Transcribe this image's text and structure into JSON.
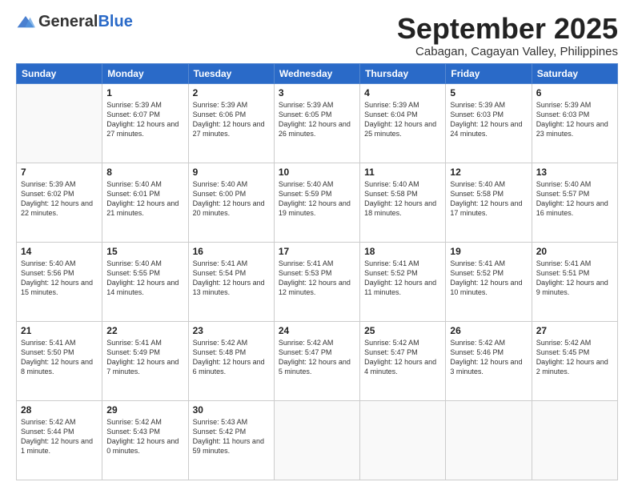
{
  "header": {
    "logo_general": "General",
    "logo_blue": "Blue",
    "month_title": "September 2025",
    "location": "Cabagan, Cagayan Valley, Philippines"
  },
  "weekdays": [
    "Sunday",
    "Monday",
    "Tuesday",
    "Wednesday",
    "Thursday",
    "Friday",
    "Saturday"
  ],
  "weeks": [
    [
      {
        "day": "",
        "info": ""
      },
      {
        "day": "1",
        "info": "Sunrise: 5:39 AM\nSunset: 6:07 PM\nDaylight: 12 hours\nand 27 minutes."
      },
      {
        "day": "2",
        "info": "Sunrise: 5:39 AM\nSunset: 6:06 PM\nDaylight: 12 hours\nand 27 minutes."
      },
      {
        "day": "3",
        "info": "Sunrise: 5:39 AM\nSunset: 6:05 PM\nDaylight: 12 hours\nand 26 minutes."
      },
      {
        "day": "4",
        "info": "Sunrise: 5:39 AM\nSunset: 6:04 PM\nDaylight: 12 hours\nand 25 minutes."
      },
      {
        "day": "5",
        "info": "Sunrise: 5:39 AM\nSunset: 6:03 PM\nDaylight: 12 hours\nand 24 minutes."
      },
      {
        "day": "6",
        "info": "Sunrise: 5:39 AM\nSunset: 6:03 PM\nDaylight: 12 hours\nand 23 minutes."
      }
    ],
    [
      {
        "day": "7",
        "info": "Sunrise: 5:39 AM\nSunset: 6:02 PM\nDaylight: 12 hours\nand 22 minutes."
      },
      {
        "day": "8",
        "info": "Sunrise: 5:40 AM\nSunset: 6:01 PM\nDaylight: 12 hours\nand 21 minutes."
      },
      {
        "day": "9",
        "info": "Sunrise: 5:40 AM\nSunset: 6:00 PM\nDaylight: 12 hours\nand 20 minutes."
      },
      {
        "day": "10",
        "info": "Sunrise: 5:40 AM\nSunset: 5:59 PM\nDaylight: 12 hours\nand 19 minutes."
      },
      {
        "day": "11",
        "info": "Sunrise: 5:40 AM\nSunset: 5:58 PM\nDaylight: 12 hours\nand 18 minutes."
      },
      {
        "day": "12",
        "info": "Sunrise: 5:40 AM\nSunset: 5:58 PM\nDaylight: 12 hours\nand 17 minutes."
      },
      {
        "day": "13",
        "info": "Sunrise: 5:40 AM\nSunset: 5:57 PM\nDaylight: 12 hours\nand 16 minutes."
      }
    ],
    [
      {
        "day": "14",
        "info": "Sunrise: 5:40 AM\nSunset: 5:56 PM\nDaylight: 12 hours\nand 15 minutes."
      },
      {
        "day": "15",
        "info": "Sunrise: 5:40 AM\nSunset: 5:55 PM\nDaylight: 12 hours\nand 14 minutes."
      },
      {
        "day": "16",
        "info": "Sunrise: 5:41 AM\nSunset: 5:54 PM\nDaylight: 12 hours\nand 13 minutes."
      },
      {
        "day": "17",
        "info": "Sunrise: 5:41 AM\nSunset: 5:53 PM\nDaylight: 12 hours\nand 12 minutes."
      },
      {
        "day": "18",
        "info": "Sunrise: 5:41 AM\nSunset: 5:52 PM\nDaylight: 12 hours\nand 11 minutes."
      },
      {
        "day": "19",
        "info": "Sunrise: 5:41 AM\nSunset: 5:52 PM\nDaylight: 12 hours\nand 10 minutes."
      },
      {
        "day": "20",
        "info": "Sunrise: 5:41 AM\nSunset: 5:51 PM\nDaylight: 12 hours\nand 9 minutes."
      }
    ],
    [
      {
        "day": "21",
        "info": "Sunrise: 5:41 AM\nSunset: 5:50 PM\nDaylight: 12 hours\nand 8 minutes."
      },
      {
        "day": "22",
        "info": "Sunrise: 5:41 AM\nSunset: 5:49 PM\nDaylight: 12 hours\nand 7 minutes."
      },
      {
        "day": "23",
        "info": "Sunrise: 5:42 AM\nSunset: 5:48 PM\nDaylight: 12 hours\nand 6 minutes."
      },
      {
        "day": "24",
        "info": "Sunrise: 5:42 AM\nSunset: 5:47 PM\nDaylight: 12 hours\nand 5 minutes."
      },
      {
        "day": "25",
        "info": "Sunrise: 5:42 AM\nSunset: 5:47 PM\nDaylight: 12 hours\nand 4 minutes."
      },
      {
        "day": "26",
        "info": "Sunrise: 5:42 AM\nSunset: 5:46 PM\nDaylight: 12 hours\nand 3 minutes."
      },
      {
        "day": "27",
        "info": "Sunrise: 5:42 AM\nSunset: 5:45 PM\nDaylight: 12 hours\nand 2 minutes."
      }
    ],
    [
      {
        "day": "28",
        "info": "Sunrise: 5:42 AM\nSunset: 5:44 PM\nDaylight: 12 hours\nand 1 minute."
      },
      {
        "day": "29",
        "info": "Sunrise: 5:42 AM\nSunset: 5:43 PM\nDaylight: 12 hours\nand 0 minutes."
      },
      {
        "day": "30",
        "info": "Sunrise: 5:43 AM\nSunset: 5:42 PM\nDaylight: 11 hours\nand 59 minutes."
      },
      {
        "day": "",
        "info": ""
      },
      {
        "day": "",
        "info": ""
      },
      {
        "day": "",
        "info": ""
      },
      {
        "day": "",
        "info": ""
      }
    ]
  ]
}
